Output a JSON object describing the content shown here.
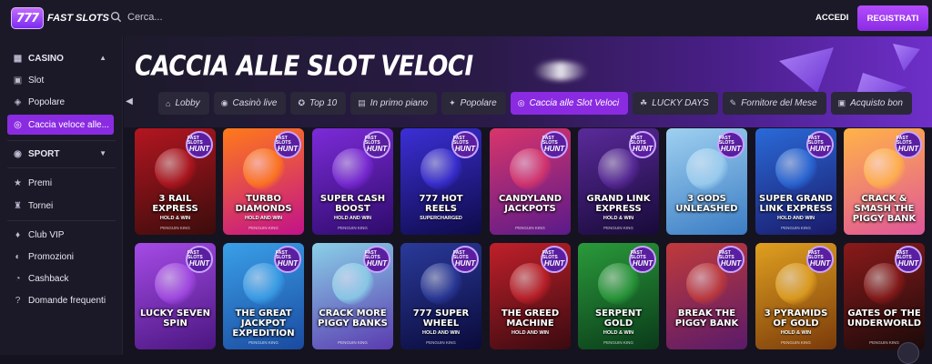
{
  "header": {
    "logo_badge": "777",
    "logo_text": "FAST SLOTS",
    "search_placeholder": "Cerca...",
    "login_label": "ACCEDI",
    "register_label": "REGISTRATI"
  },
  "sidebar": {
    "items": [
      {
        "label": "CASINO",
        "icon": "casino-icon"
      },
      {
        "label": "Slot",
        "icon": "slot-icon"
      },
      {
        "label": "Popolare",
        "icon": "popular-icon"
      },
      {
        "label": "Caccia veloce alle...",
        "icon": "hunt-icon"
      },
      {
        "label": "SPORT",
        "icon": "sport-icon"
      },
      {
        "label": "Premi",
        "icon": "star-icon"
      },
      {
        "label": "Tornei",
        "icon": "trophy-icon"
      },
      {
        "label": "Club VIP",
        "icon": "vip-icon"
      },
      {
        "label": "Promozioni",
        "icon": "promo-icon"
      },
      {
        "label": "Cashback",
        "icon": "cashback-icon"
      },
      {
        "label": "Domande frequenti",
        "icon": "faq-icon"
      }
    ]
  },
  "page": {
    "title": "CACCIA ALLE SLOT VELOCI"
  },
  "tabs": [
    {
      "label": "Lobby",
      "icon": "lobby-icon"
    },
    {
      "label": "Casinò live",
      "icon": "live-icon"
    },
    {
      "label": "Top 10",
      "icon": "top10-icon"
    },
    {
      "label": "In primo piano",
      "icon": "featured-icon"
    },
    {
      "label": "Popolare",
      "icon": "sparkle-icon"
    },
    {
      "label": "Caccia alle Slot Veloci",
      "icon": "hunt-icon"
    },
    {
      "label": "LUCKY DAYS",
      "icon": "lucky-icon"
    },
    {
      "label": "Fornitore del Mese",
      "icon": "provider-icon"
    },
    {
      "label": "Acquisto bon",
      "icon": "bonus-buy-icon"
    }
  ],
  "badge": {
    "line1": "FAST SLOTS",
    "line2": "HUNT"
  },
  "games": [
    {
      "name": "3 RAIL EXPRESS",
      "sub": "HOLD & WIN",
      "provider": "PENGUIN KING",
      "c1": "#b31620",
      "c2": "#3a0c0c"
    },
    {
      "name": "TURBO DIAMONDS",
      "sub": "HOLD AND WIN",
      "provider": "PENGUIN KING",
      "c1": "#ff7a1a",
      "c2": "#c2128a"
    },
    {
      "name": "SUPER CASH BOOST",
      "sub": "HOLD AND WIN",
      "provider": "PENGUIN KING",
      "c1": "#7c2bd8",
      "c2": "#2e0b6b"
    },
    {
      "name": "777 HOT REELS",
      "sub": "SUPERCHARGED",
      "provider": "",
      "c1": "#3b2fd6",
      "c2": "#0e0b48"
    },
    {
      "name": "CANDYLAND JACKPOTS",
      "sub": "",
      "provider": "PENGUIN KING",
      "c1": "#d9356b",
      "c2": "#5a1a8a"
    },
    {
      "name": "GRAND LINK EXPRESS",
      "sub": "HOLD & WIN",
      "provider": "PENGUIN KING",
      "c1": "#5a2a9a",
      "c2": "#170a38"
    },
    {
      "name": "3 GODS UNLEASHED",
      "sub": "",
      "provider": "",
      "c1": "#9fd0f0",
      "c2": "#3a7cc4"
    },
    {
      "name": "SUPER GRAND LINK EXPRESS",
      "sub": "HOLD AND WIN",
      "provider": "PENGUIN KING",
      "c1": "#2a6ad8",
      "c2": "#1a1a6a"
    },
    {
      "name": "CRACK & SMASH THE PIGGY BANK",
      "sub": "",
      "provider": "",
      "c1": "#ffb347",
      "c2": "#e0559a"
    },
    {
      "name": "LUCKY SEVEN SPIN",
      "sub": "",
      "provider": "",
      "c1": "#a54be6",
      "c2": "#4a1680"
    },
    {
      "name": "THE GREAT JACKPOT EXPEDITION",
      "sub": "",
      "provider": "PENGUIN KING",
      "c1": "#3aa0e8",
      "c2": "#1a4aa0"
    },
    {
      "name": "CRACK MORE PIGGY BANKS",
      "sub": "",
      "provider": "PENGUIN KING",
      "c1": "#8ad0e8",
      "c2": "#5a3ab0"
    },
    {
      "name": "777 SUPER WHEEL",
      "sub": "HOLD AND WIN",
      "provider": "PENGUIN KING",
      "c1": "#2a3a9a",
      "c2": "#0a0a3a"
    },
    {
      "name": "THE GREED MACHINE",
      "sub": "HOLD AND WIN",
      "provider": "",
      "c1": "#c0202a",
      "c2": "#3a0a10"
    },
    {
      "name": "SERPENT GOLD",
      "sub": "HOLD & WIN",
      "provider": "PENGUIN KING",
      "c1": "#2a9a3a",
      "c2": "#0a3a1a"
    },
    {
      "name": "BREAK THE PIGGY BANK",
      "sub": "",
      "provider": "",
      "c1": "#c03a3a",
      "c2": "#5a1a6a"
    },
    {
      "name": "3 PYRAMIDS OF GOLD",
      "sub": "HOLD & WIN",
      "provider": "PENGUIN KING",
      "c1": "#e0a020",
      "c2": "#7a3a0a"
    },
    {
      "name": "GATES OF THE UNDERWORLD",
      "sub": "",
      "provider": "PENGUIN KING",
      "c1": "#8a1a1a",
      "c2": "#1a0a0a"
    }
  ]
}
